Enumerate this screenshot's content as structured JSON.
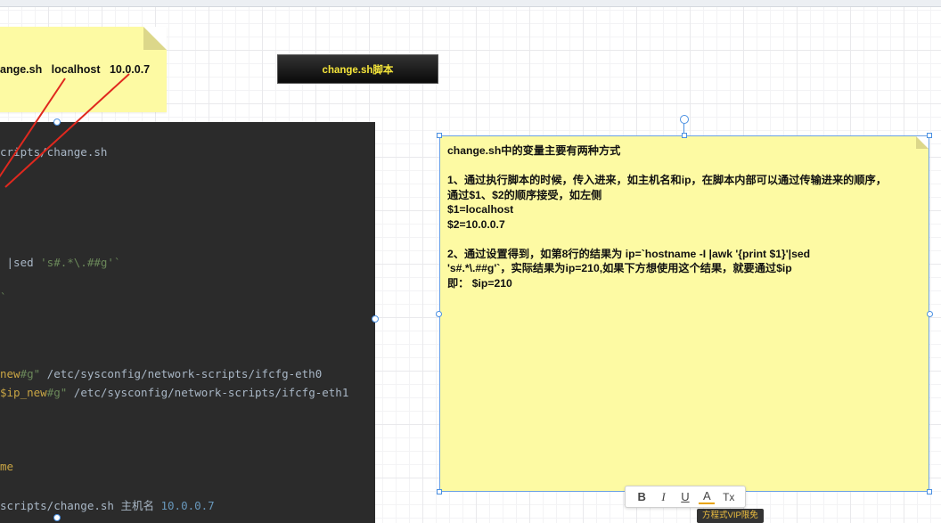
{
  "note_top": {
    "command": "ange.sh   localhost   10.0.0.7"
  },
  "title_box": {
    "label": "change.sh脚本"
  },
  "code": {
    "lines": [
      {
        "segments": [
          {
            "t": "cripts/change.sh",
            "c": ""
          }
        ]
      },
      {
        "segments": [
          {
            "t": " |sed ",
            "c": ""
          },
          {
            "t": "'s#.*\\.##g'`",
            "c": "c-green"
          }
        ]
      },
      {
        "segments": [
          {
            "t": "`",
            "c": "c-green"
          }
        ]
      },
      {
        "segments": [
          {
            "t": "new",
            "c": "c-yellow"
          },
          {
            "t": "#g\"",
            "c": "c-green"
          },
          {
            "t": " /etc/sysconfig/network-scripts/ifcfg-eth0",
            "c": ""
          }
        ]
      },
      {
        "segments": [
          {
            "t": "$ip_new",
            "c": "c-yellow"
          },
          {
            "t": "#g\"",
            "c": "c-green"
          },
          {
            "t": " /etc/sysconfig/network-scripts/ifcfg-eth1",
            "c": ""
          }
        ]
      },
      {
        "segments": [
          {
            "t": "me",
            "c": "c-yellow"
          }
        ]
      },
      {
        "segments": [
          {
            "t": "scripts/change.sh 主机名 ",
            "c": ""
          },
          {
            "t": "10.0.0.7",
            "c": "c-num"
          }
        ]
      }
    ]
  },
  "note_main": {
    "lines": [
      "change.sh中的变量主要有两种方式",
      "",
      "1、通过执行脚本的时候，传入进来，如主机名和ip，在脚本内部可以通过传输进来的顺序，",
      "通过$1、$2的顺序接受，如左侧",
      "$1=localhost",
      "$2=10.0.0.7",
      "",
      "2、通过设置得到，如第8行的结果为 ip=`hostname -I |awk '{print $1}'|sed",
      "'s#.*\\.##g'`，实际结果为ip=210,如果下方想使用这个结果，就要通过$ip",
      "即： $ip=210"
    ]
  },
  "format_toolbar": {
    "bold": "B",
    "italic": "I",
    "underline": "U",
    "font_color": "A",
    "clear_format": "Tx"
  },
  "tooltip": {
    "text": "方程式VIP限免"
  },
  "colors": {
    "note_yellow": "#fdfaa3",
    "code_bg": "#2b2b2b",
    "selection_blue": "#4a90e2",
    "arrow_red": "#e0281e"
  }
}
